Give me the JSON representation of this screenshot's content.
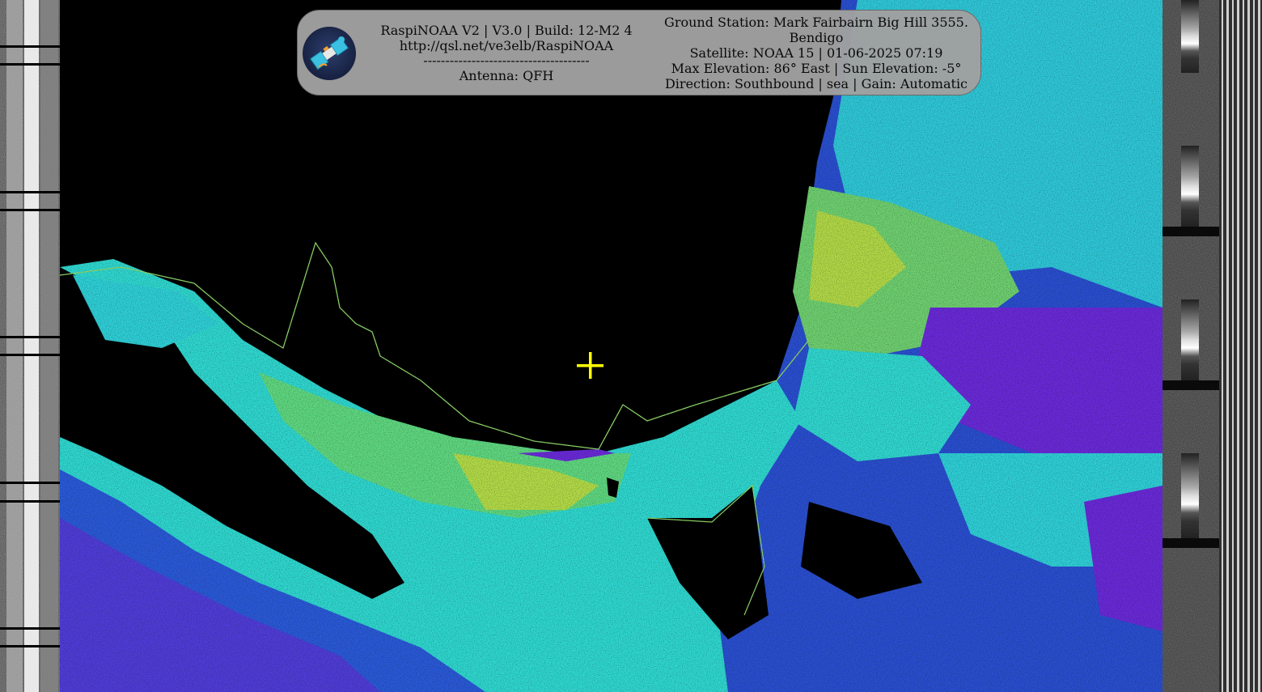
{
  "header": {
    "app_line": "RaspiNOAA V2 | V3.0 | Build: 12-M2 4",
    "url": "http://qsl.net/ve3elb/RaspiNOAA",
    "separator": "--------------------------------------",
    "antenna": "Antenna: QFH",
    "ground_station_line1": "Ground Station: Mark Fairbairn Big Hill 3555.",
    "ground_station_line2": "Bendigo",
    "satellite_line": "Satellite: NOAA 15 | 01-06-2025 07:19",
    "elevation_line": "Max Elevation: 86° East | Sun Elevation: -5°",
    "direction_line": "Direction: Southbound | sea | Gain: Automatic"
  },
  "icons": {
    "logo": "satellite-icon",
    "marker": "crosshair-icon"
  },
  "colors": {
    "overlay_bg": "#a0a0a0",
    "land_mask": "#000000",
    "cloud_cyan": "#2fe0d8",
    "cloud_green": "#5fd87a",
    "cloud_yellow": "#d6e23a",
    "cloud_purple": "#7a2fe0",
    "cloud_blue": "#2f5ae0",
    "crosshair": "#ffff00"
  }
}
